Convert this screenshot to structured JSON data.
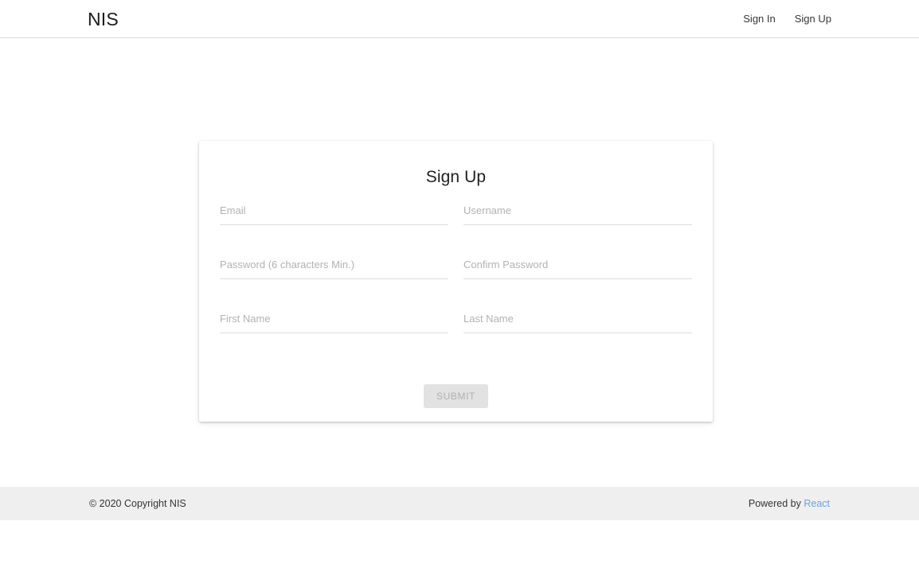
{
  "header": {
    "brand": "NIS",
    "nav": [
      {
        "label": "Sign In",
        "name": "nav-link-sign-in"
      },
      {
        "label": "Sign Up",
        "name": "nav-link-sign-up"
      }
    ]
  },
  "card": {
    "title": "Sign Up",
    "fields": [
      [
        {
          "placeholder": "Email",
          "value": ""
        },
        {
          "placeholder": "Username",
          "value": ""
        }
      ],
      [
        {
          "placeholder": "Password (6 characters Min.)",
          "value": ""
        },
        {
          "placeholder": "Confirm Password",
          "value": ""
        }
      ],
      [
        {
          "placeholder": "First Name",
          "value": ""
        },
        {
          "placeholder": "Last Name",
          "value": ""
        }
      ]
    ],
    "submit_label": "SUBMIT",
    "submit_disabled": true
  },
  "footer": {
    "copyright": "© 2020 Copyright NIS",
    "powered_prefix": "Powered by ",
    "powered_link": "React"
  },
  "colors": {
    "page_background": "#ffffff",
    "footer_background": "#efefef",
    "header_border": "#dadada",
    "input_underline": "#dcdcdc",
    "placeholder": "#b2b2b2",
    "text": "#212121",
    "link": "#6aa3e0",
    "button_disabled_bg": "#e2e2e2",
    "button_disabled_text": "#b0b0b0"
  }
}
